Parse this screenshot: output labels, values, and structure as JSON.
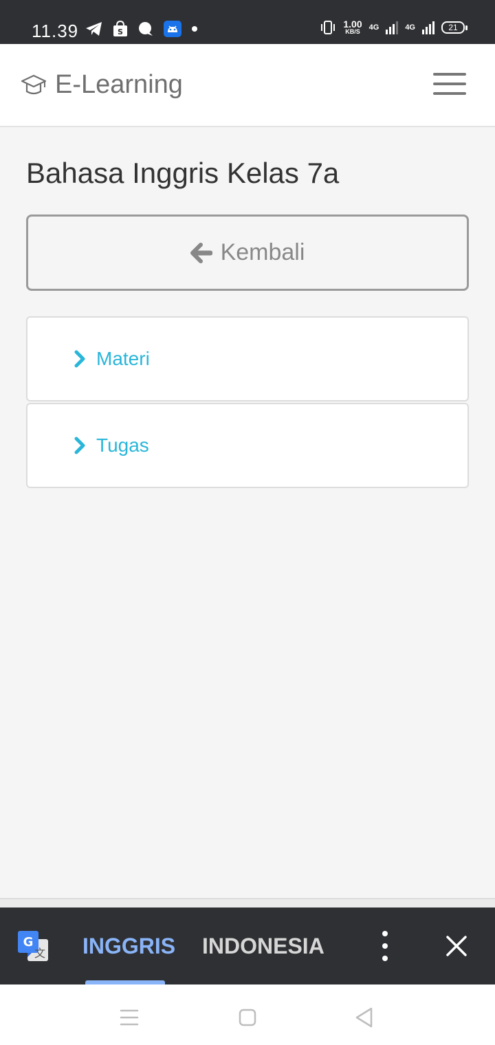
{
  "status_bar": {
    "time": "11.39",
    "left_icons": [
      "telegram-icon",
      "shopee-icon",
      "chat-bubble-icon",
      "android-icon",
      "notification-dot-icon"
    ],
    "speed_value": "1.00",
    "speed_unit": "KB/S",
    "network_1": "4G",
    "network_2": "4G",
    "battery": "21"
  },
  "header": {
    "brand_icon": "graduation-cap-icon",
    "brand_name": "E-Learning",
    "menu_icon": "hamburger-menu-icon"
  },
  "main": {
    "page_title": "Bahasa Inggris Kelas 7a",
    "back_button": {
      "icon": "arrow-left-icon",
      "label": "Kembali"
    },
    "items": [
      {
        "icon": "chevron-right-icon",
        "label": "Materi"
      },
      {
        "icon": "chevron-right-icon",
        "label": "Tugas"
      }
    ],
    "link_color": "#29b6d9"
  },
  "translate_bar": {
    "logo": "google-translate-icon",
    "languages": [
      {
        "label": "INGGRIS",
        "selected": true
      },
      {
        "label": "INDONESIA",
        "selected": false
      }
    ],
    "active_color": "#8ab4f8",
    "more_icon": "more-vertical-icon",
    "close_icon": "close-icon"
  },
  "nav_bar": {
    "buttons": [
      "recents-icon",
      "home-icon",
      "back-icon"
    ]
  }
}
